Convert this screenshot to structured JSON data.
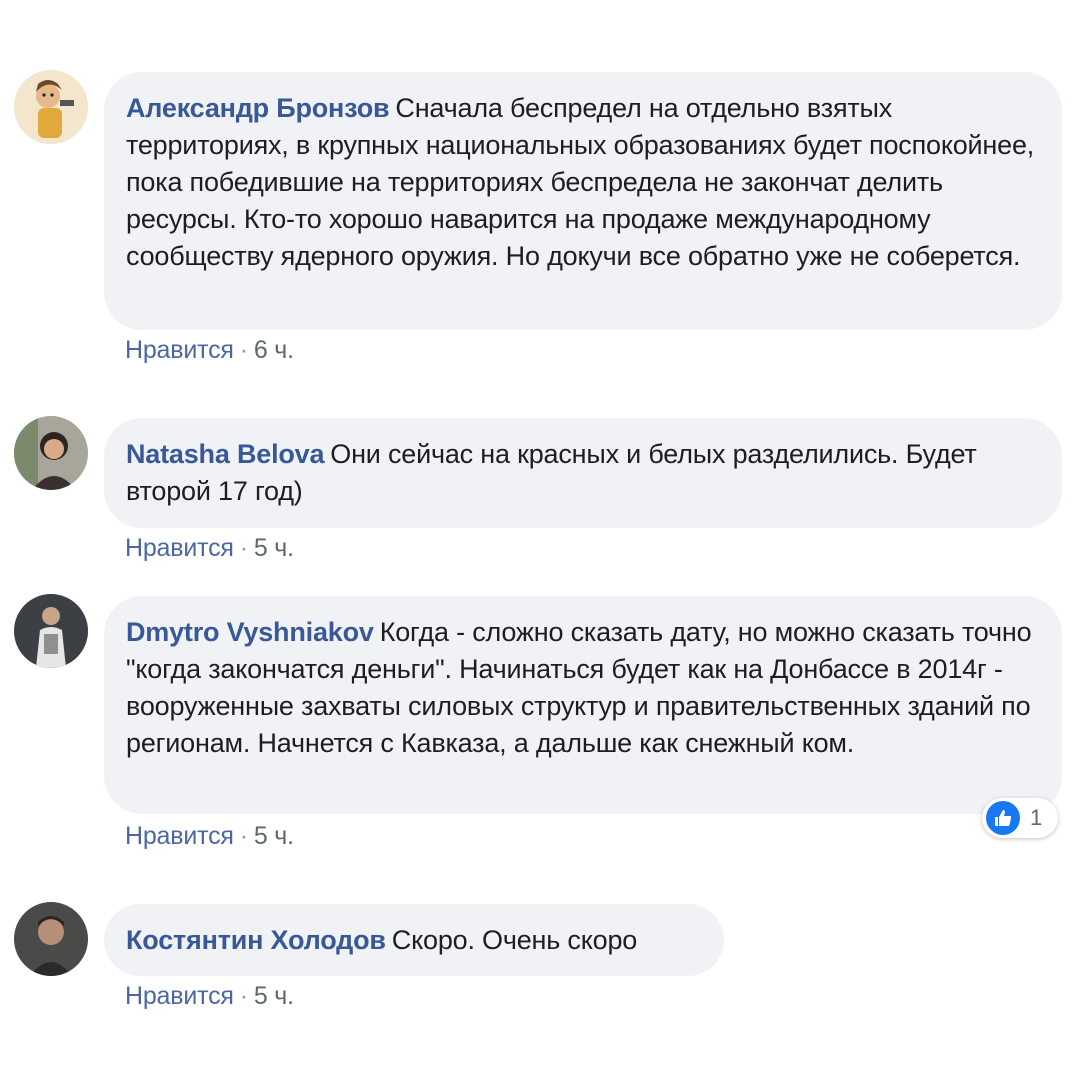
{
  "comments": [
    {
      "author": "Александр Бронзов",
      "text": "Сначала беспредел на отдельно взятых территориях, в крупных национальных образованиях будет поспокойнее, пока победившие на территориях беспредела не закончат делить ресурсы. Кто-то хорошо наварится на продаже международному сообществу ядерного оружия. Но докучи все обратно уже не соберется.",
      "like_label": "Нравится",
      "separator": "·",
      "time": "6 ч."
    },
    {
      "author": "Natasha Belova",
      "text": "Они сейчас на красных и белых разделились. Будет второй 17 год)",
      "like_label": "Нравится",
      "separator": "·",
      "time": "5 ч."
    },
    {
      "author": "Dmytro Vyshniakov",
      "text": "Когда - сложно сказать дату, но можно сказать точно \"когда закончатся деньги\". Начинаться будет как на Донбассе в 2014г - вооруженные захваты силовых структур и правительственных зданий по регионам. Начнется с Кавказа, а дальше как снежный ком.",
      "like_label": "Нравится",
      "separator": "·",
      "time": "5 ч.",
      "reaction_count": "1",
      "reaction_icon": "like-thumb-icon",
      "reaction_color": "#1877f2"
    },
    {
      "author": "Костянтин Холодов",
      "text": "Скоро. Очень скоро",
      "like_label": "Нравится",
      "separator": "·",
      "time": "5 ч."
    }
  ],
  "colors": {
    "author": "#385898",
    "bubble": "#f0f2f5",
    "meta": "#606770"
  }
}
